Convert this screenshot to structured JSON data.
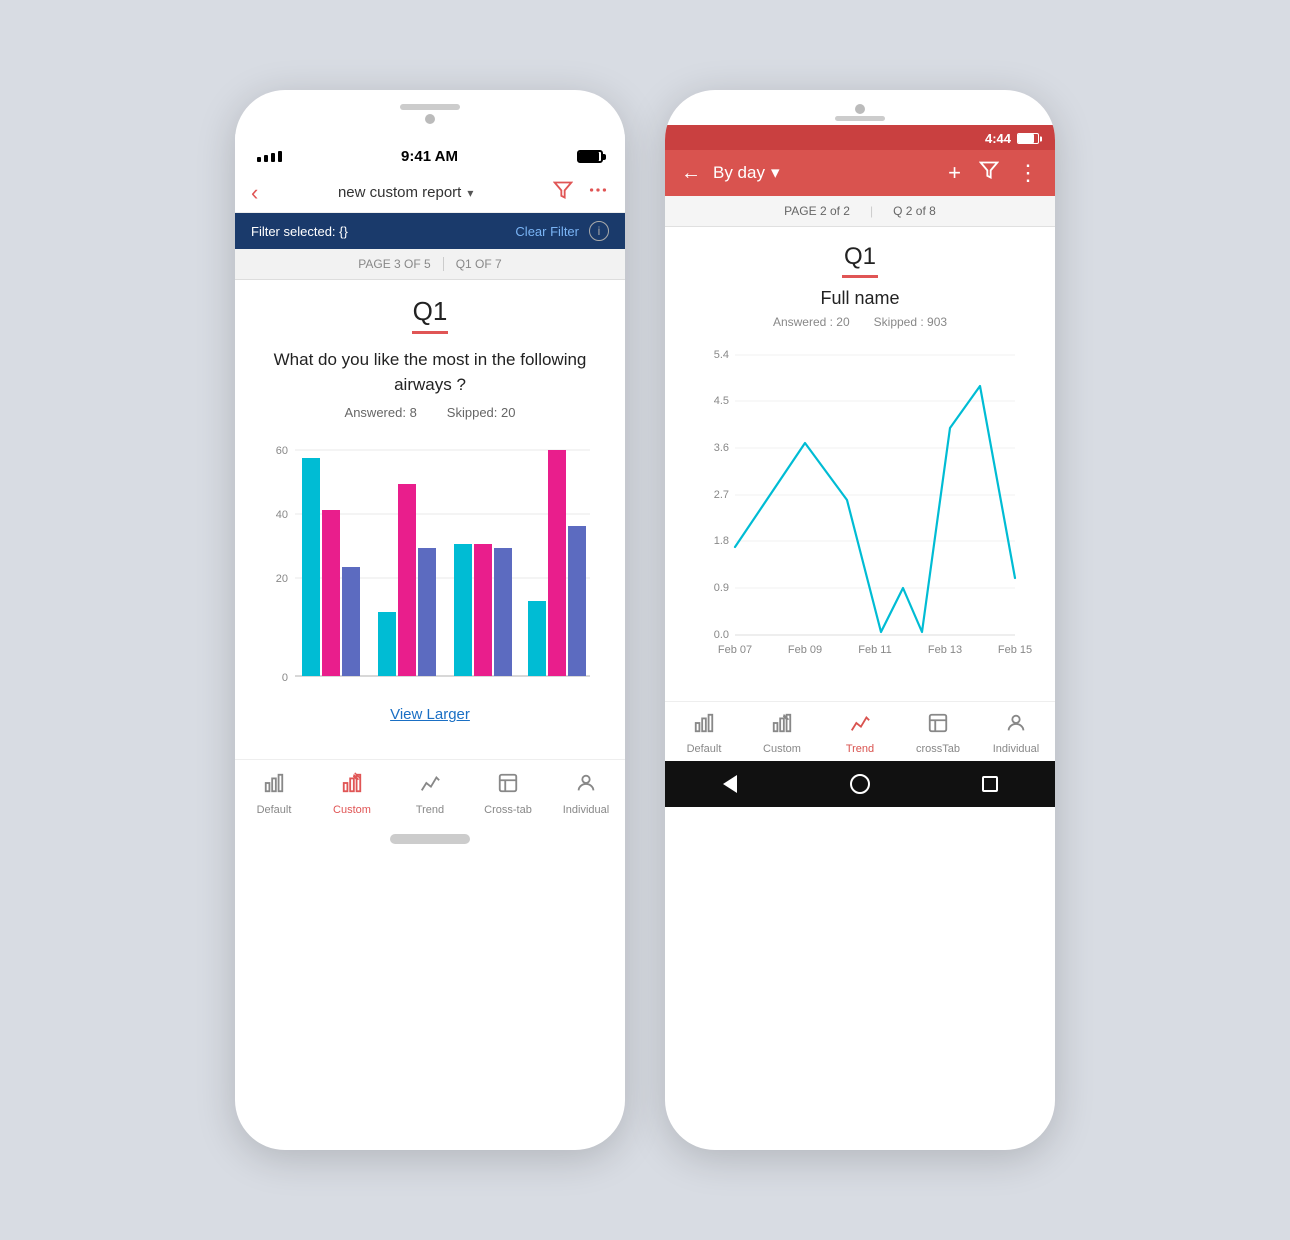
{
  "background_color": "#d8dce3",
  "ios_phone": {
    "status_bar": {
      "signal_dots": "●●●●",
      "time": "9:41 AM",
      "battery": "full"
    },
    "nav_bar": {
      "back_label": "‹",
      "title": "new custom report",
      "chevron": "▾",
      "filter_icon": "filter",
      "more_icon": "•••"
    },
    "filter_bar": {
      "label": "Filter selected: {}",
      "clear": "Clear Filter",
      "info": "ℹ"
    },
    "page_bar": {
      "page_label": "PAGE 3  OF 5",
      "q_label": "Q1  OF 7"
    },
    "question": {
      "number": "Q1",
      "text": "What do you like the most in the following airways ?",
      "answered_label": "Answered: 8",
      "skipped_label": "Skipped: 20"
    },
    "chart": {
      "y_labels": [
        "0",
        "20",
        "40",
        "60"
      ],
      "groups": [
        {
          "bars": [
            58,
            44,
            29
          ]
        },
        {
          "bars": [
            17,
            51,
            34
          ]
        },
        {
          "bars": [
            35,
            35,
            34
          ]
        },
        {
          "bars": [
            20,
            60,
            40
          ]
        }
      ],
      "colors": [
        "#00bcd4",
        "#e91e8c",
        "#5c6bc0"
      ],
      "view_larger": "View Larger"
    },
    "bottom_tabs": [
      {
        "id": "default",
        "label": "Default",
        "icon": "bar-chart",
        "active": false
      },
      {
        "id": "custom",
        "label": "Custom",
        "icon": "edit-chart",
        "active": true
      },
      {
        "id": "trend",
        "label": "Trend",
        "icon": "line-chart",
        "active": false
      },
      {
        "id": "crosstab",
        "label": "Cross-tab",
        "icon": "crosstab",
        "active": false
      },
      {
        "id": "individual",
        "label": "Individual",
        "icon": "person",
        "active": false
      }
    ]
  },
  "android_phone": {
    "status_bar": {
      "time": "4:44",
      "battery": "full"
    },
    "toolbar": {
      "back_icon": "←",
      "title": "By day",
      "chevron": "▾",
      "add_icon": "+",
      "filter_icon": "filter",
      "more_icon": "⋮"
    },
    "page_bar": {
      "page_label": "PAGE 2 of 2",
      "q_label": "Q 2 of 8"
    },
    "question": {
      "number": "Q1",
      "name": "Full name",
      "answered_label": "Answered : 20",
      "skipped_label": "Skipped : 903"
    },
    "chart": {
      "y_labels": [
        "0.0",
        "0.9",
        "1.8",
        "2.7",
        "3.6",
        "4.5",
        "5.4"
      ],
      "x_labels": [
        "Feb 07",
        "Feb 09",
        "Feb 11",
        "Feb 13",
        "Feb 15"
      ],
      "color": "#00bcd4",
      "data_points": [
        {
          "x": 0,
          "y": 1.7
        },
        {
          "x": 0.25,
          "y": 3.7
        },
        {
          "x": 0.4,
          "y": 2.6
        },
        {
          "x": 0.52,
          "y": 0.05
        },
        {
          "x": 0.6,
          "y": 0.9
        },
        {
          "x": 0.67,
          "y": 0.05
        },
        {
          "x": 0.77,
          "y": 4.0
        },
        {
          "x": 0.88,
          "y": 4.8
        },
        {
          "x": 1.0,
          "y": 1.1
        }
      ]
    },
    "bottom_tabs": [
      {
        "id": "default",
        "label": "Default",
        "icon": "bar-chart",
        "active": false
      },
      {
        "id": "custom",
        "label": "Custom",
        "icon": "edit-chart",
        "active": false
      },
      {
        "id": "trend",
        "label": "Trend",
        "icon": "line-chart",
        "active": true
      },
      {
        "id": "crosstab",
        "label": "crossTab",
        "icon": "crosstab",
        "active": false
      },
      {
        "id": "individual",
        "label": "Individual",
        "icon": "person",
        "active": false
      }
    ],
    "nav_bar": {
      "back": "◄",
      "home": "●",
      "recent": "■"
    }
  }
}
